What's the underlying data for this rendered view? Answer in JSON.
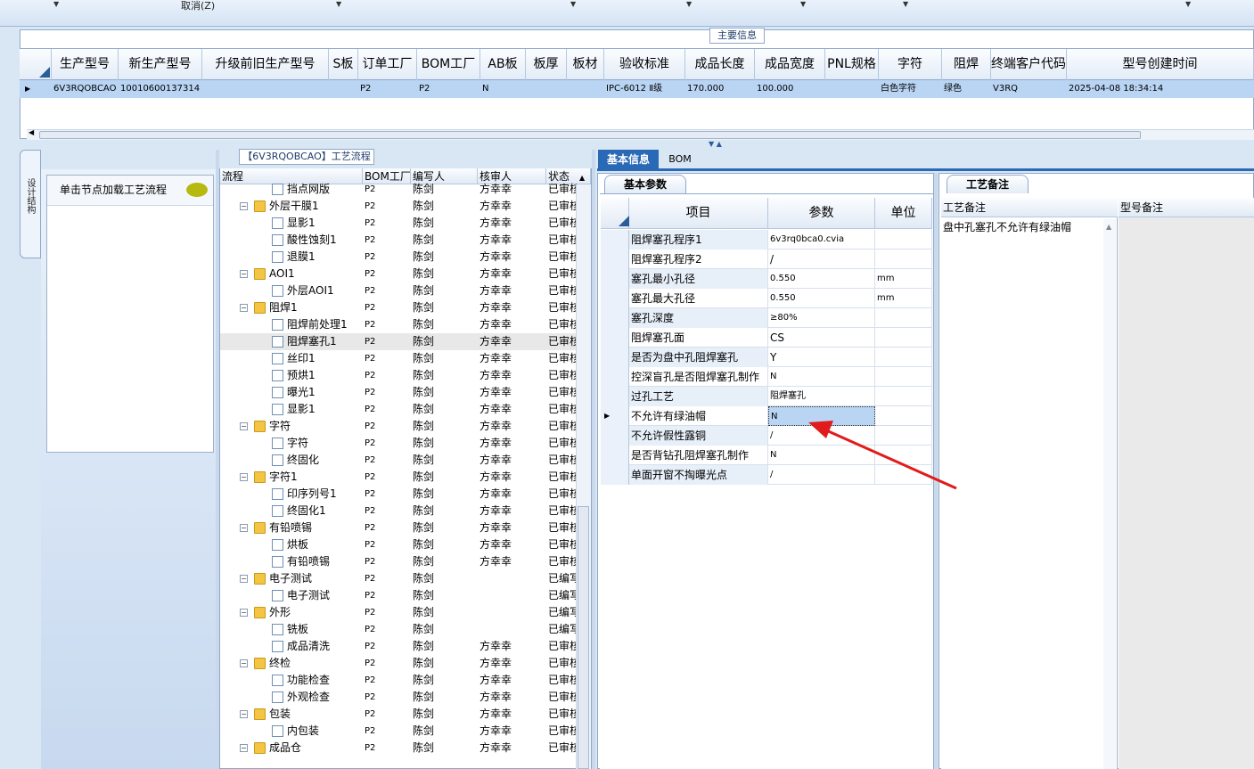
{
  "toolbar": {
    "cancel_label": "取消(Z)"
  },
  "main_info": {
    "title": "主要信息",
    "columns": [
      "生产型号",
      "新生产型号",
      "升级前旧生产型号",
      "S板",
      "订单工厂",
      "BOM工厂",
      "AB板",
      "板厚",
      "板材",
      "验收标准",
      "成品长度",
      "成品宽度",
      "PNL规格",
      "字符",
      "阻焊",
      "终端客户代码",
      "型号创建时间"
    ],
    "row": [
      "6V3RQOBCAO",
      "10010600137314",
      "",
      "",
      "P2",
      "P2",
      "N",
      "",
      "",
      "IPC-6012 Ⅱ级",
      "170.000",
      "100.000",
      "",
      "白色字符",
      "绿色",
      "V3RQ",
      "2025-04-08 18:34:14"
    ]
  },
  "nav": {
    "side_tab": "设计结构",
    "item": "单击节点加载工艺流程"
  },
  "tree": {
    "title": "【6V3RQOBCAO】工艺流程",
    "columns": [
      "流程",
      "BOM工厂",
      "编写人",
      "核审人",
      "状态"
    ],
    "rows": [
      {
        "name": "挡点网版",
        "level": 1,
        "bom": "P2",
        "writer": "陈剑",
        "checker": "方幸幸",
        "status": "已审核"
      },
      {
        "name": "外层干膜1",
        "level": 0,
        "bom": "P2",
        "writer": "陈剑",
        "checker": "方幸幸",
        "status": "已审核"
      },
      {
        "name": "显影1",
        "level": 1,
        "bom": "P2",
        "writer": "陈剑",
        "checker": "方幸幸",
        "status": "已审核"
      },
      {
        "name": "酸性蚀刻1",
        "level": 1,
        "bom": "P2",
        "writer": "陈剑",
        "checker": "方幸幸",
        "status": "已审核"
      },
      {
        "name": "退膜1",
        "level": 1,
        "bom": "P2",
        "writer": "陈剑",
        "checker": "方幸幸",
        "status": "已审核"
      },
      {
        "name": "AOI1",
        "level": 0,
        "bom": "P2",
        "writer": "陈剑",
        "checker": "方幸幸",
        "status": "已审核"
      },
      {
        "name": "外层AOI1",
        "level": 1,
        "bom": "P2",
        "writer": "陈剑",
        "checker": "方幸幸",
        "status": "已审核"
      },
      {
        "name": "阻焊1",
        "level": 0,
        "bom": "P2",
        "writer": "陈剑",
        "checker": "方幸幸",
        "status": "已审核"
      },
      {
        "name": "阻焊前处理1",
        "level": 1,
        "bom": "P2",
        "writer": "陈剑",
        "checker": "方幸幸",
        "status": "已审核"
      },
      {
        "name": "阻焊塞孔1",
        "level": 1,
        "bom": "P2",
        "writer": "陈剑",
        "checker": "方幸幸",
        "status": "已审核"
      },
      {
        "name": "丝印1",
        "level": 1,
        "bom": "P2",
        "writer": "陈剑",
        "checker": "方幸幸",
        "status": "已审核"
      },
      {
        "name": "预烘1",
        "level": 1,
        "bom": "P2",
        "writer": "陈剑",
        "checker": "方幸幸",
        "status": "已审核"
      },
      {
        "name": "曝光1",
        "level": 1,
        "bom": "P2",
        "writer": "陈剑",
        "checker": "方幸幸",
        "status": "已审核"
      },
      {
        "name": "显影1",
        "level": 1,
        "bom": "P2",
        "writer": "陈剑",
        "checker": "方幸幸",
        "status": "已审核"
      },
      {
        "name": "字符",
        "level": 0,
        "bom": "P2",
        "writer": "陈剑",
        "checker": "方幸幸",
        "status": "已审核"
      },
      {
        "name": "字符",
        "level": 1,
        "bom": "P2",
        "writer": "陈剑",
        "checker": "方幸幸",
        "status": "已审核"
      },
      {
        "name": "终固化",
        "level": 1,
        "bom": "P2",
        "writer": "陈剑",
        "checker": "方幸幸",
        "status": "已审核"
      },
      {
        "name": "字符1",
        "level": 0,
        "bom": "P2",
        "writer": "陈剑",
        "checker": "方幸幸",
        "status": "已审核"
      },
      {
        "name": "印序列号1",
        "level": 1,
        "bom": "P2",
        "writer": "陈剑",
        "checker": "方幸幸",
        "status": "已审核"
      },
      {
        "name": "终固化1",
        "level": 1,
        "bom": "P2",
        "writer": "陈剑",
        "checker": "方幸幸",
        "status": "已审核"
      },
      {
        "name": "有铅喷锡",
        "level": 0,
        "bom": "P2",
        "writer": "陈剑",
        "checker": "方幸幸",
        "status": "已审核"
      },
      {
        "name": "烘板",
        "level": 1,
        "bom": "P2",
        "writer": "陈剑",
        "checker": "方幸幸",
        "status": "已审核"
      },
      {
        "name": "有铅喷锡",
        "level": 1,
        "bom": "P2",
        "writer": "陈剑",
        "checker": "方幸幸",
        "status": "已审核"
      },
      {
        "name": "电子测试",
        "level": 0,
        "bom": "P2",
        "writer": "陈剑",
        "checker": "",
        "status": "已编写"
      },
      {
        "name": "电子测试",
        "level": 1,
        "bom": "P2",
        "writer": "陈剑",
        "checker": "",
        "status": "已编写"
      },
      {
        "name": "外形",
        "level": 0,
        "bom": "P2",
        "writer": "陈剑",
        "checker": "",
        "status": "已编写"
      },
      {
        "name": "铣板",
        "level": 1,
        "bom": "P2",
        "writer": "陈剑",
        "checker": "",
        "status": "已编写"
      },
      {
        "name": "成品清洗",
        "level": 1,
        "bom": "P2",
        "writer": "陈剑",
        "checker": "方幸幸",
        "status": "已审核"
      },
      {
        "name": "终检",
        "level": 0,
        "bom": "P2",
        "writer": "陈剑",
        "checker": "方幸幸",
        "status": "已审核"
      },
      {
        "name": "功能检查",
        "level": 1,
        "bom": "P2",
        "writer": "陈剑",
        "checker": "方幸幸",
        "status": "已审核"
      },
      {
        "name": "外观检查",
        "level": 1,
        "bom": "P2",
        "writer": "陈剑",
        "checker": "方幸幸",
        "status": "已审核"
      },
      {
        "name": "包装",
        "level": 0,
        "bom": "P2",
        "writer": "陈剑",
        "checker": "方幸幸",
        "status": "已审核"
      },
      {
        "name": "内包装",
        "level": 1,
        "bom": "P2",
        "writer": "陈剑",
        "checker": "方幸幸",
        "status": "已审核"
      },
      {
        "name": "成品仓",
        "level": 0,
        "bom": "P2",
        "writer": "陈剑",
        "checker": "方幸幸",
        "status": "已审核"
      }
    ]
  },
  "tabs": {
    "basic": "基本信息",
    "bom": "BOM"
  },
  "basic_params": {
    "tab": "基本参数",
    "columns": [
      "项目",
      "参数",
      "单位"
    ],
    "rows": [
      {
        "item": "阻焊塞孔程序1",
        "param": "6v3rq0bca0.cvia",
        "unit": ""
      },
      {
        "item": "阻焊塞孔程序2",
        "param": "/",
        "unit": ""
      },
      {
        "item": "塞孔最小孔径",
        "param": "0.550",
        "unit": "mm"
      },
      {
        "item": "塞孔最大孔径",
        "param": "0.550",
        "unit": "mm"
      },
      {
        "item": "塞孔深度",
        "param": "≥80%",
        "unit": ""
      },
      {
        "item": "阻焊塞孔面",
        "param": "CS",
        "unit": ""
      },
      {
        "item": "是否为盘中孔阻焊塞孔",
        "param": "Y",
        "unit": ""
      },
      {
        "item": "控深盲孔是否阻焊塞孔制作",
        "param": "N",
        "unit": ""
      },
      {
        "item": "过孔工艺",
        "param": "阻焊塞孔",
        "unit": ""
      },
      {
        "item": "不允许有绿油帽",
        "param": "N",
        "unit": ""
      },
      {
        "item": "不允许假性露铜",
        "param": "/",
        "unit": ""
      },
      {
        "item": "是否背钻孔阻焊塞孔制作",
        "param": "N",
        "unit": ""
      },
      {
        "item": "单面开窗不掏曝光点",
        "param": "/",
        "unit": ""
      }
    ]
  },
  "remarks": {
    "tab": "工艺备注",
    "col1": "工艺备注",
    "col2": "型号备注",
    "text": "盘中孔塞孔不允许有绿油帽"
  },
  "colors": {
    "accent": "#2a69b6",
    "selected_row": "#b9d5f3",
    "annotation": "#e11b1b"
  }
}
